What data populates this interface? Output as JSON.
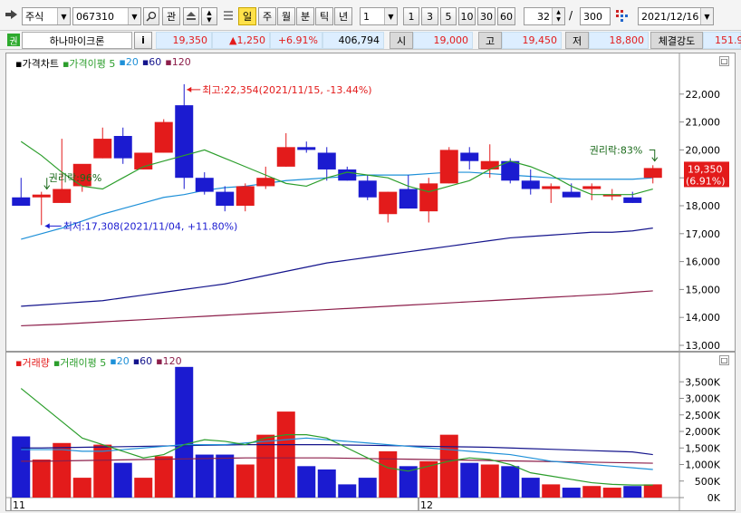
{
  "toolbar": {
    "market": "주식",
    "code": "067310",
    "gwan": "관",
    "periods": [
      "일",
      "주",
      "월",
      "분",
      "틱",
      "년"
    ],
    "selected_period": "일",
    "interval_value": "1",
    "quick": [
      "1",
      "3",
      "5",
      "10",
      "30",
      "60"
    ],
    "count": "32",
    "count_sep": "/",
    "total": "300",
    "date": "2021/12/16"
  },
  "quote": {
    "badge": "권",
    "name": "하나마이크론",
    "info": "i",
    "price": "19,350",
    "change": "▲1,250",
    "change_pct": "+6.91%",
    "volume": "406,794",
    "open_label": "시",
    "open": "19,000",
    "high_label": "고",
    "high": "19,450",
    "low_label": "저",
    "low": "18,800",
    "strength_label": "체결강도",
    "strength": "151.9"
  },
  "colors": {
    "up": "#e31b1b",
    "down": "#1b1bd0",
    "ma5": "#2c9e2c",
    "ma20": "#1e90d8",
    "ma60": "#14148c",
    "ma120": "#8c1e4a"
  },
  "price_chart": {
    "legend": [
      {
        "text": "가격차트",
        "color": "#000000"
      },
      {
        "text": "가격이평 5",
        "color": "#2c9e2c"
      },
      {
        "text": "20",
        "color": "#1e90d8"
      },
      {
        "text": "60",
        "color": "#14148c"
      },
      {
        "text": "120",
        "color": "#8c1e4a"
      }
    ],
    "y_labels": [
      "22,000",
      "21,000",
      "20,000",
      "19,000",
      "18,000",
      "17,000",
      "16,000",
      "15,000",
      "14,000",
      "13,000"
    ],
    "annotations": {
      "high": "최고:22,354(2021/11/15, -13.44%)",
      "low": "최저:17,308(2021/11/04, +11.80%)",
      "rights1": "권리락:96%",
      "rights2": "권리락:83%",
      "last_price": "19,350",
      "last_pct": "(6.91%)"
    }
  },
  "volume_chart": {
    "legend": [
      {
        "text": "거래량",
        "color": "#e31b1b"
      },
      {
        "text": "거래이평 5",
        "color": "#2c9e2c"
      },
      {
        "text": "20",
        "color": "#1e90d8"
      },
      {
        "text": "60",
        "color": "#14148c"
      },
      {
        "text": "120",
        "color": "#8c1e4a"
      }
    ],
    "y_labels": [
      "3,500K",
      "3,000K",
      "2,500K",
      "2,000K",
      "1,500K",
      "1,000K",
      "500K",
      "0K"
    ],
    "x_labels": [
      "11",
      "12"
    ]
  },
  "chart_data": {
    "type": "candlestick",
    "price_ylim": [
      13000,
      23000
    ],
    "volume_ylim": [
      0,
      4000000
    ],
    "candles": [
      {
        "o": 18300,
        "h": 19000,
        "l": 18000,
        "c": 18000
      },
      {
        "o": 18300,
        "h": 18500,
        "l": 17308,
        "c": 18400
      },
      {
        "o": 18100,
        "h": 20400,
        "l": 18100,
        "c": 18600
      },
      {
        "o": 18700,
        "h": 19300,
        "l": 18500,
        "c": 19500
      },
      {
        "o": 19700,
        "h": 20800,
        "l": 19700,
        "c": 20400
      },
      {
        "o": 20500,
        "h": 20800,
        "l": 19500,
        "c": 19700
      },
      {
        "o": 19300,
        "h": 19900,
        "l": 19300,
        "c": 19900
      },
      {
        "o": 19900,
        "h": 21100,
        "l": 19900,
        "c": 21000
      },
      {
        "o": 21600,
        "h": 22354,
        "l": 18600,
        "c": 19000
      },
      {
        "o": 19000,
        "h": 19200,
        "l": 18400,
        "c": 18500
      },
      {
        "o": 18500,
        "h": 18700,
        "l": 17800,
        "c": 18000
      },
      {
        "o": 18000,
        "h": 18800,
        "l": 17800,
        "c": 18700
      },
      {
        "o": 18700,
        "h": 19400,
        "l": 18600,
        "c": 19000
      },
      {
        "o": 19400,
        "h": 20600,
        "l": 19400,
        "c": 20100
      },
      {
        "o": 20100,
        "h": 20300,
        "l": 19900,
        "c": 20000
      },
      {
        "o": 19900,
        "h": 20100,
        "l": 18900,
        "c": 19300
      },
      {
        "o": 19300,
        "h": 19400,
        "l": 18900,
        "c": 18900
      },
      {
        "o": 18900,
        "h": 19100,
        "l": 18200,
        "c": 18300
      },
      {
        "o": 17700,
        "h": 18500,
        "l": 17400,
        "c": 18500
      },
      {
        "o": 18600,
        "h": 19100,
        "l": 17900,
        "c": 17900
      },
      {
        "o": 17800,
        "h": 19000,
        "l": 17400,
        "c": 18800
      },
      {
        "o": 18800,
        "h": 20100,
        "l": 18800,
        "c": 20000
      },
      {
        "o": 19900,
        "h": 20100,
        "l": 19300,
        "c": 19600
      },
      {
        "o": 19300,
        "h": 20200,
        "l": 19000,
        "c": 19600
      },
      {
        "o": 19600,
        "h": 19700,
        "l": 18800,
        "c": 18900
      },
      {
        "o": 18900,
        "h": 19300,
        "l": 18400,
        "c": 18600
      },
      {
        "o": 18600,
        "h": 18800,
        "l": 18100,
        "c": 18700
      },
      {
        "o": 18500,
        "h": 18800,
        "l": 18400,
        "c": 18300
      },
      {
        "o": 18600,
        "h": 18800,
        "l": 18200,
        "c": 18700
      },
      {
        "o": 18400,
        "h": 18600,
        "l": 18200,
        "c": 18400
      },
      {
        "o": 18300,
        "h": 18500,
        "l": 18100,
        "c": 18100
      },
      {
        "o": 19000,
        "h": 19450,
        "l": 18800,
        "c": 19350
      }
    ],
    "volume": [
      1850000,
      1150000,
      1650000,
      600000,
      1600000,
      1050000,
      600000,
      1250000,
      3950000,
      1300000,
      1300000,
      1000000,
      1900000,
      2600000,
      950000,
      850000,
      400000,
      600000,
      1400000,
      950000,
      1100000,
      1900000,
      1050000,
      1000000,
      950000,
      600000,
      400000,
      300000,
      350000,
      300000,
      350000,
      400000
    ],
    "ma": {
      "price_ma5": [
        20300,
        19800,
        19200,
        18700,
        18600,
        19000,
        19400,
        19600,
        19800,
        20000,
        19700,
        19400,
        19100,
        18800,
        18700,
        19000,
        19200,
        19100,
        19000,
        18700,
        18500,
        18700,
        18900,
        19300,
        19600,
        19400,
        19100,
        18700,
        18400,
        18400,
        18400,
        18600
      ],
      "price_ma20": [
        16800,
        17000,
        17200,
        17450,
        17700,
        17900,
        18100,
        18300,
        18400,
        18550,
        18650,
        18700,
        18800,
        18900,
        18950,
        19000,
        19050,
        19100,
        19100,
        19100,
        19150,
        19200,
        19200,
        19150,
        19100,
        19050,
        19000,
        18950,
        18950,
        18950,
        18950,
        19000
      ],
      "price_ma60": [
        14400,
        14450,
        14500,
        14550,
        14600,
        14700,
        14800,
        14900,
        15000,
        15100,
        15200,
        15350,
        15500,
        15650,
        15800,
        15950,
        16050,
        16150,
        16250,
        16350,
        16450,
        16550,
        16650,
        16750,
        16850,
        16900,
        16950,
        17000,
        17050,
        17050,
        17100,
        17200
      ],
      "price_ma120": [
        13700,
        13730,
        13760,
        13800,
        13840,
        13880,
        13920,
        13960,
        14000,
        14040,
        14080,
        14120,
        14160,
        14200,
        14240,
        14280,
        14320,
        14360,
        14400,
        14440,
        14480,
        14520,
        14560,
        14600,
        14640,
        14680,
        14720,
        14760,
        14800,
        14840,
        14900,
        14950
      ],
      "vol_ma5": [
        3300000,
        2800000,
        2300000,
        1800000,
        1600000,
        1400000,
        1200000,
        1300000,
        1600000,
        1750000,
        1700000,
        1600000,
        1800000,
        1900000,
        1900000,
        1800000,
        1500000,
        1200000,
        900000,
        800000,
        950000,
        1100000,
        1200000,
        1150000,
        1000000,
        750000,
        650000,
        550000,
        450000,
        400000,
        380000,
        380000
      ],
      "vol_ma20": [
        1450000,
        1450000,
        1450000,
        1400000,
        1400000,
        1450000,
        1500000,
        1550000,
        1600000,
        1600000,
        1600000,
        1650000,
        1700000,
        1750000,
        1800000,
        1750000,
        1700000,
        1650000,
        1600000,
        1550000,
        1500000,
        1450000,
        1400000,
        1350000,
        1300000,
        1200000,
        1100000,
        1050000,
        1000000,
        950000,
        900000,
        850000
      ],
      "vol_ma60": [
        1500000,
        1500000,
        1510000,
        1520000,
        1530000,
        1540000,
        1550000,
        1560000,
        1570000,
        1580000,
        1590000,
        1600000,
        1600000,
        1600000,
        1600000,
        1600000,
        1590000,
        1580000,
        1570000,
        1560000,
        1550000,
        1540000,
        1530000,
        1520000,
        1500000,
        1480000,
        1460000,
        1440000,
        1420000,
        1400000,
        1380000,
        1300000
      ],
      "vol_ma120": [
        1100000,
        1100000,
        1110000,
        1120000,
        1130000,
        1140000,
        1150000,
        1160000,
        1170000,
        1180000,
        1190000,
        1200000,
        1200000,
        1200000,
        1200000,
        1200000,
        1190000,
        1180000,
        1170000,
        1160000,
        1150000,
        1140000,
        1130000,
        1120000,
        1110000,
        1100000,
        1090000,
        1080000,
        1070000,
        1060000,
        1050000,
        1040000
      ]
    }
  }
}
